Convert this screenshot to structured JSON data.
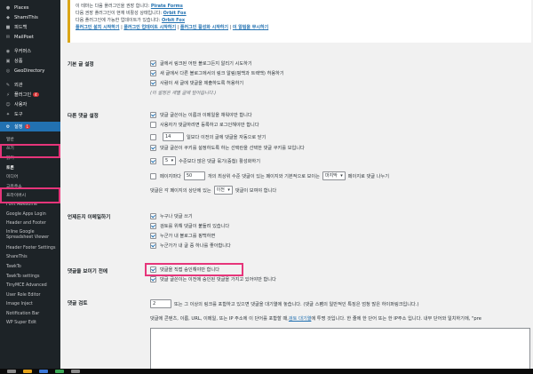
{
  "colors": {
    "sidebar_bg": "#1d2327",
    "highlight": "#e6357a",
    "link": "#2271b1",
    "notice_border": "#dba617",
    "active": "#2271b1"
  },
  "sidebar": {
    "items": [
      {
        "label": "Places",
        "icon": "pin-icon"
      },
      {
        "label": "ShamiThis",
        "icon": "share-icon"
      },
      {
        "label": "피드백",
        "icon": "feedback-icon"
      },
      {
        "label": "MailPoet",
        "icon": "mail-icon"
      },
      {
        "label": "우커머스",
        "icon": "woo-icon"
      },
      {
        "label": "상품",
        "icon": "box-icon"
      },
      {
        "label": "GeoDirectory",
        "icon": "globe-icon"
      },
      {
        "label": "외관",
        "icon": "brush-icon"
      },
      {
        "label": "플러그인",
        "icon": "plugin-icon",
        "badge": "4"
      },
      {
        "label": "사용자",
        "icon": "user-icon"
      },
      {
        "label": "도구",
        "icon": "wrench-icon"
      },
      {
        "label": "설정",
        "icon": "settings-icon",
        "badge": "1"
      }
    ],
    "sub_items": [
      "일반",
      "쓰기",
      "읽기",
      "토론",
      "미디어",
      "고유주소",
      "프라이버시",
      "Font Awesome",
      "Google Apps Login",
      "Header and Footer",
      "Inline Google Spreadsheet Viewer",
      "Header Footer Settings",
      "ShareThis",
      "TawkTo",
      "TawkTo settings",
      "TinyMCE Advanced",
      "User Role Editor",
      "Image Inject",
      "Notification Bar",
      "WP Super Edit"
    ]
  },
  "notice": {
    "line1_pre": "이 테마는 다음 플러그인을 권장 합니다: ",
    "line1_link": "Pirate Forms",
    "line2_pre": "다음 권장 플러그인이 현재 비활성 상태입니다: ",
    "line2_link": "Orbit Fox",
    "line3_pre": "다음 플러그인에 가능한 업데이트가 있습니다: ",
    "line3_link": "Orbit Fox",
    "links": [
      "플러그인 설치 시작하기",
      "플러그인 업데이트 시작하기",
      "플러그인 활성화 시작하기",
      "이 알림을 무시하기"
    ]
  },
  "sections": {
    "default_settings": {
      "label": "기본 글 설정",
      "options": [
        "글에서 링크된 어떤 블로그든지 알리기 시도하기",
        "새 글에서 다른 블로그에서의 링크 알림(핑백과 트랙백) 허용하기",
        "사람이 새 글에 댓글을 제출하도록 허용하기"
      ],
      "note": "(이 설정은 개별 글에 덮어씁니다.)"
    },
    "other_comments": {
      "label": "다른 댓글 설정",
      "opt1": "댓글 글쓴이는 이름과 이메일을 채워야만 합니다",
      "opt2": "사용자가 댓글하려면 등록하고 로그인해야만 합니다",
      "close_days": "14",
      "opt3_suffix": "일보다 이전의 글에 댓글을 자동으로 닫기",
      "opt4": "댓글 글쓴이 쿠키를 설정하도록 하는 선택란을 선택한 댓글 쿠키를 보입니다",
      "depth": "5",
      "opt5_suffix": "수준보다 많은 댓글 묶기(중첩) 활성화하기",
      "opt6_pre": "페이지마다",
      "per_page": "50",
      "opt6_mid": "개의 최상위 수준 댓글이 있는 페이지와 기본적으로 보이는",
      "page_select": "마지막",
      "opt6_suf": "페이지로 댓글 나누기",
      "opt7_pre": "댓글은 각 페이지의 상단에 있는",
      "order_select": "이전",
      "opt7_suf": "댓글이 보여야 합니다"
    },
    "email_me": {
      "label": "언제든지 이메일하기",
      "options": [
        "누구나 댓글 쓰기",
        "검토를 위해 댓글이 붙들려 있습니다",
        "누군가 내 블로그를 핑백하면",
        "누군가가 내 글 중 하나를 좋아합니다"
      ]
    },
    "before_appears": {
      "label": "댓글을 보이기 전에",
      "opt1": "댓글을 직접 승인해야만 합니다",
      "opt2": "댓글 글쓴이는 이전에 승인된 댓글을 가지고 있어야만 합니다"
    },
    "moderation": {
      "label": "댓글 검토",
      "links_count": "2",
      "line1": "또는 그 이상의 링크를 포함하고 있으면 댓글을 대기열에 놓습니다. (댓글 스팸의 일반적인 특징은 엄청 많은 하이퍼링크입니다.)",
      "line2_pre": "댓글에 콘텐츠, 이름, URL, 이메일, 또는 IP 주소에 이 단어를 포함할 때, ",
      "line2_link": "검토 대기열",
      "line2_suf": "에 투명 것입니다. 한 줄에 한 단어 또는 한 IP주소 입니다. 내부 단어와 일치하기에, \"pre"
    }
  }
}
